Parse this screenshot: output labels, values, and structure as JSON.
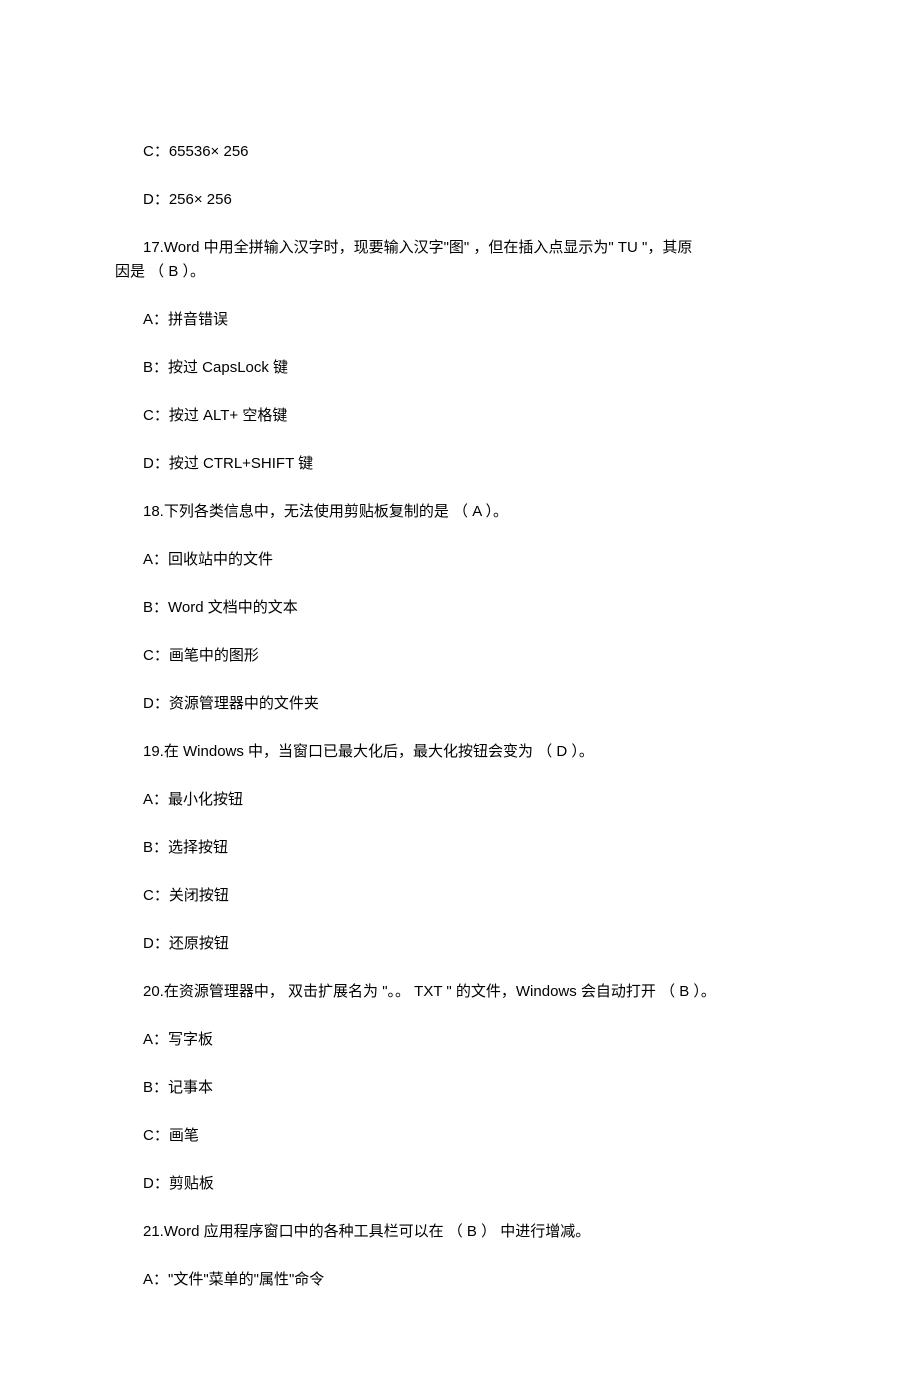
{
  "pre_options": {
    "c": "C：65536× 256",
    "d": "D：256× 256"
  },
  "q17": {
    "stem_line1": "17.Word  中用全拼输入汉字时，现要输入汉字\"图\"    ，但在插入点显示为\"   TU \"，其原",
    "stem_line2": "因是  （ B ）。",
    "a": "A：拼音错误",
    "b": "B：按过  CapsLock  键",
    "c": "C：按过  ALT+ 空格键",
    "d": "D：按过  CTRL+SHIFT   键"
  },
  "q18": {
    "stem": "18.下列各类信息中，无法使用剪贴板复制的是       （ A  ）。",
    "a": "A：回收站中的文件",
    "b": "B：Word  文档中的文本",
    "c": "C：画笔中的图形",
    "d": "D：资源管理器中的文件夹"
  },
  "q19": {
    "stem": "19.在 Windows   中，当窗口已最大化后，最大化按钮会变为       （ D  ）。",
    "a": "A：最小化按钮",
    "b": "B：选择按钮",
    "c": "C：关闭按钮",
    "d": "D：还原按钮"
  },
  "q20": {
    "stem": "20.在资源管理器中，  双击扩展名为 \"。。 TXT \" 的文件，Windows  会自动打开   （ B  ）。",
    "a": "A：写字板",
    "b": "B：记事本",
    "c": "C：画笔",
    "d": "D：剪贴板"
  },
  "q21": {
    "stem": "21.Word  应用程序窗口中的各种工具栏可以在     （ B ）  中进行增减。",
    "a": "A：\"文件\"菜单的\"属性\"命令"
  }
}
